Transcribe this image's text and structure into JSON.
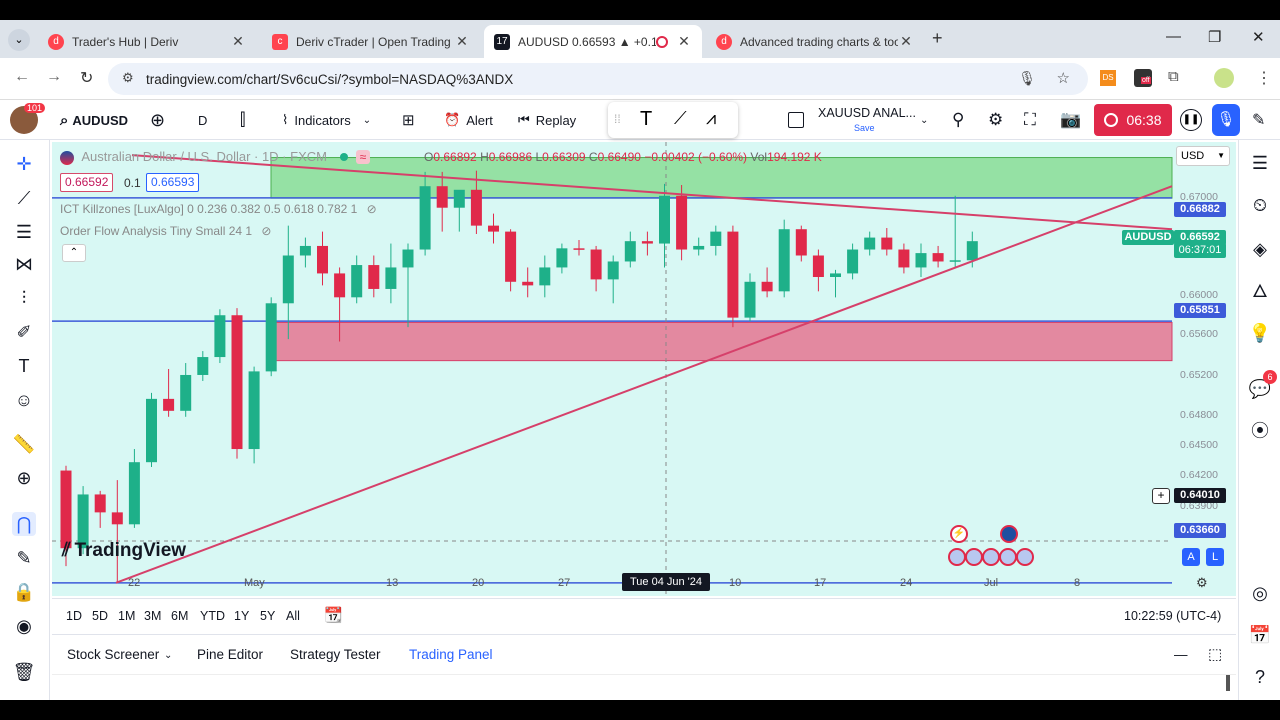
{
  "browser": {
    "tabs": [
      {
        "title": "Trader's Hub | Deriv",
        "active": false
      },
      {
        "title": "Deriv cTrader | Open Trading Pl",
        "active": false
      },
      {
        "title": "AUDUSD 0.66593 ▲ +0.18%",
        "active": true
      },
      {
        "title": "Advanced trading charts & tool",
        "active": false
      }
    ],
    "url": "tradingview.com/chart/Sv6cuCsi/?symbol=NASDAQ%3ANDX"
  },
  "toolbar": {
    "avatar_badge": "101",
    "symbol": "AUDUSD",
    "interval": "D",
    "indicators": "Indicators",
    "alert": "Alert",
    "replay": "Replay",
    "layout_name": "XAUUSD ANAL...",
    "save": "Save",
    "timer": "06:38"
  },
  "chart": {
    "title": "Australian Dollar / U.S. Dollar · 1D · FXCM",
    "ohlc": {
      "o": "0.66892",
      "h": "0.66986",
      "l": "0.66309",
      "c": "0.66490",
      "chg": "−0.00402 (−0.60%)",
      "vol": "194.192 K"
    },
    "sell_price": "0.66592",
    "spread": "0.1",
    "buy_price": "0.66593",
    "indicator1": "ICT Killzones [LuxAlgo] 0 0.236 0.382 0.5 0.618 0.782 1",
    "indicator2": "Order Flow Analysis Tiny Small 24 1",
    "currency": "USD",
    "price_ticks": [
      "0.67000",
      "0.66600",
      "0.66000",
      "0.65600",
      "0.65200",
      "0.64800",
      "0.64500",
      "0.64200",
      "0.63900"
    ],
    "price_labels": [
      {
        "value": "0.66882",
        "style": "blue"
      },
      {
        "value": "AUDUSD",
        "style": "green"
      },
      {
        "value": "0.66592",
        "style": "green"
      },
      {
        "value": "06:37:01",
        "style": "green"
      },
      {
        "value": "0.65851",
        "style": "blue"
      },
      {
        "value": "0.64010",
        "style": "dark"
      },
      {
        "value": "0.63660",
        "style": "blue"
      }
    ],
    "x_labels": [
      "22",
      "May",
      "13",
      "20",
      "27",
      "10",
      "17",
      "24",
      "Jul",
      "8"
    ],
    "crosshair_date": "Tue 04 Jun '24",
    "watermark": "TradingView",
    "colors": {
      "bull": "#1eb089",
      "bear": "#e0294a",
      "background": "#d8f8f4",
      "supply_zone": "#7fd98a",
      "demand_zone": "#e57590",
      "trendline": "#d6406a",
      "level_line": "#3d5bd9"
    },
    "chart_data": {
      "type": "candlestick",
      "candles": [
        {
          "o": 0.646,
          "h": 0.6464,
          "l": 0.638,
          "c": 0.6395
        },
        {
          "o": 0.6395,
          "h": 0.6447,
          "l": 0.639,
          "c": 0.644
        },
        {
          "o": 0.644,
          "h": 0.6443,
          "l": 0.6412,
          "c": 0.6425
        },
        {
          "o": 0.6425,
          "h": 0.6452,
          "l": 0.6366,
          "c": 0.6415
        },
        {
          "o": 0.6415,
          "h": 0.6478,
          "l": 0.6412,
          "c": 0.6467
        },
        {
          "o": 0.6467,
          "h": 0.6525,
          "l": 0.6463,
          "c": 0.652
        },
        {
          "o": 0.652,
          "h": 0.6545,
          "l": 0.6505,
          "c": 0.651
        },
        {
          "o": 0.651,
          "h": 0.655,
          "l": 0.6505,
          "c": 0.654
        },
        {
          "o": 0.654,
          "h": 0.656,
          "l": 0.6535,
          "c": 0.6555
        },
        {
          "o": 0.6555,
          "h": 0.6595,
          "l": 0.655,
          "c": 0.659
        },
        {
          "o": 0.659,
          "h": 0.6596,
          "l": 0.647,
          "c": 0.6478
        },
        {
          "o": 0.6478,
          "h": 0.6547,
          "l": 0.6466,
          "c": 0.6543
        },
        {
          "o": 0.6543,
          "h": 0.6605,
          "l": 0.6539,
          "c": 0.66
        },
        {
          "o": 0.66,
          "h": 0.6665,
          "l": 0.657,
          "c": 0.664
        },
        {
          "o": 0.664,
          "h": 0.6655,
          "l": 0.663,
          "c": 0.6648
        },
        {
          "o": 0.6648,
          "h": 0.666,
          "l": 0.6615,
          "c": 0.6625
        },
        {
          "o": 0.6625,
          "h": 0.663,
          "l": 0.6568,
          "c": 0.6605
        },
        {
          "o": 0.6605,
          "h": 0.664,
          "l": 0.66,
          "c": 0.6632
        },
        {
          "o": 0.6632,
          "h": 0.664,
          "l": 0.6605,
          "c": 0.6612
        },
        {
          "o": 0.6612,
          "h": 0.665,
          "l": 0.66,
          "c": 0.663
        },
        {
          "o": 0.663,
          "h": 0.665,
          "l": 0.658,
          "c": 0.6645
        },
        {
          "o": 0.6645,
          "h": 0.671,
          "l": 0.664,
          "c": 0.6698
        },
        {
          "o": 0.6698,
          "h": 0.671,
          "l": 0.666,
          "c": 0.668
        },
        {
          "o": 0.668,
          "h": 0.669,
          "l": 0.666,
          "c": 0.6695
        },
        {
          "o": 0.6695,
          "h": 0.6711,
          "l": 0.6658,
          "c": 0.6665
        },
        {
          "o": 0.6665,
          "h": 0.6675,
          "l": 0.665,
          "c": 0.666
        },
        {
          "o": 0.666,
          "h": 0.6662,
          "l": 0.661,
          "c": 0.6618
        },
        {
          "o": 0.6618,
          "h": 0.663,
          "l": 0.6605,
          "c": 0.6615
        },
        {
          "o": 0.6615,
          "h": 0.664,
          "l": 0.6605,
          "c": 0.663
        },
        {
          "o": 0.663,
          "h": 0.665,
          "l": 0.6625,
          "c": 0.6646
        },
        {
          "o": 0.6646,
          "h": 0.6653,
          "l": 0.664,
          "c": 0.6645
        },
        {
          "o": 0.6645,
          "h": 0.6648,
          "l": 0.661,
          "c": 0.662
        },
        {
          "o": 0.662,
          "h": 0.664,
          "l": 0.66,
          "c": 0.6635
        },
        {
          "o": 0.6635,
          "h": 0.666,
          "l": 0.663,
          "c": 0.6652
        },
        {
          "o": 0.6652,
          "h": 0.666,
          "l": 0.664,
          "c": 0.665
        },
        {
          "o": 0.665,
          "h": 0.67,
          "l": 0.663,
          "c": 0.669
        },
        {
          "o": 0.669,
          "h": 0.6699,
          "l": 0.6636,
          "c": 0.6645
        },
        {
          "o": 0.6645,
          "h": 0.6655,
          "l": 0.664,
          "c": 0.6648
        },
        {
          "o": 0.6648,
          "h": 0.6665,
          "l": 0.664,
          "c": 0.666
        },
        {
          "o": 0.666,
          "h": 0.6665,
          "l": 0.658,
          "c": 0.6588
        },
        {
          "o": 0.6588,
          "h": 0.6625,
          "l": 0.6585,
          "c": 0.6618
        },
        {
          "o": 0.6618,
          "h": 0.663,
          "l": 0.6605,
          "c": 0.661
        },
        {
          "o": 0.661,
          "h": 0.667,
          "l": 0.6605,
          "c": 0.6662
        },
        {
          "o": 0.6662,
          "h": 0.6665,
          "l": 0.6635,
          "c": 0.664
        },
        {
          "o": 0.664,
          "h": 0.6645,
          "l": 0.661,
          "c": 0.6622
        },
        {
          "o": 0.6622,
          "h": 0.6628,
          "l": 0.6605,
          "c": 0.6625
        },
        {
          "o": 0.6625,
          "h": 0.665,
          "l": 0.662,
          "c": 0.6645
        },
        {
          "o": 0.6645,
          "h": 0.666,
          "l": 0.664,
          "c": 0.6655
        },
        {
          "o": 0.6655,
          "h": 0.6663,
          "l": 0.664,
          "c": 0.6645
        },
        {
          "o": 0.6645,
          "h": 0.665,
          "l": 0.6625,
          "c": 0.663
        },
        {
          "o": 0.663,
          "h": 0.665,
          "l": 0.6622,
          "c": 0.6642
        },
        {
          "o": 0.6642,
          "h": 0.6648,
          "l": 0.663,
          "c": 0.6635
        },
        {
          "o": 0.6635,
          "h": 0.669,
          "l": 0.663,
          "c": 0.6636
        },
        {
          "o": 0.6636,
          "h": 0.666,
          "l": 0.663,
          "c": 0.6652
        }
      ],
      "zones": {
        "supply": [
          0.6688,
          0.6722
        ],
        "demand": [
          0.6552,
          0.6584
        ]
      },
      "levels": [
        0.66882,
        0.65851,
        0.6366
      ],
      "ylim": [
        0.6355,
        0.6735
      ]
    }
  },
  "timeframes": [
    "1D",
    "5D",
    "1M",
    "3M",
    "6M",
    "YTD",
    "1Y",
    "5Y",
    "All"
  ],
  "clock": "10:22:59 (UTC-4)",
  "panels": [
    "Stock Screener",
    "Pine Editor",
    "Strategy Tester",
    "Trading Panel"
  ],
  "notifications": "6"
}
